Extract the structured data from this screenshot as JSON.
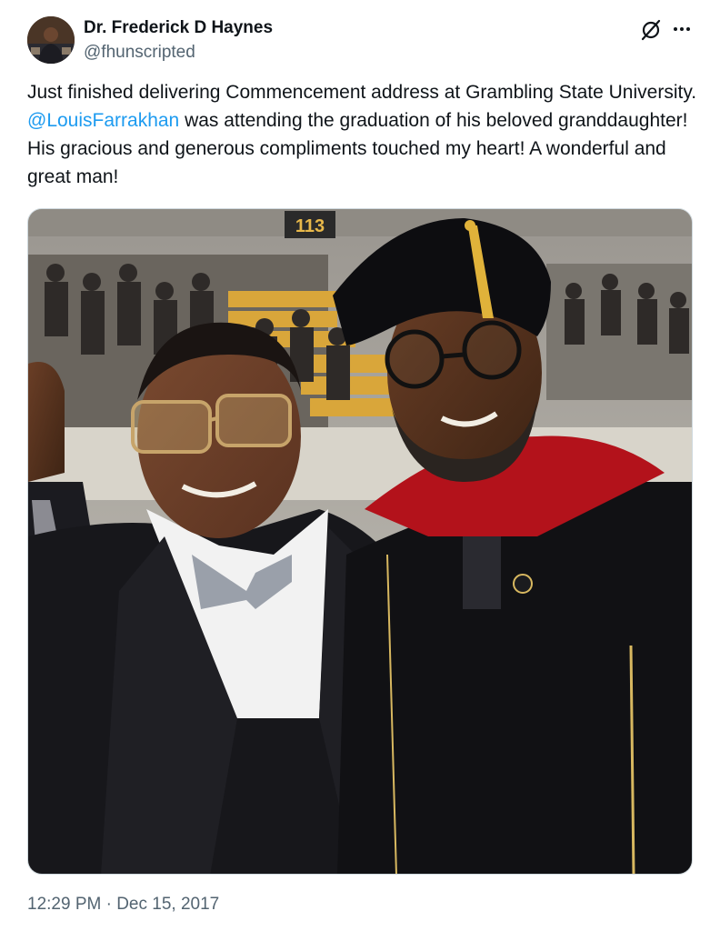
{
  "author": {
    "name": "Dr. Frederick D Haynes",
    "handle": "@fhunscripted"
  },
  "tweet": {
    "text_before": "Just finished delivering Commencement address at Grambling State University. ",
    "mention": "@LouisFarrakhan",
    "text_after": " was attending the graduation of his beloved granddaughter! His gracious and generous compliments touched my heart! A wonderful and great man!"
  },
  "media": {
    "scoreboard_text": "113"
  },
  "meta": {
    "timestamp": "12:29 PM · Dec 15, 2017"
  },
  "icons": {
    "grok": "grok-icon",
    "more": "more-options-icon"
  },
  "colors": {
    "text": "#0f1419",
    "secondary": "#536471",
    "link": "#1d9bf0",
    "hood_red": "#b3121b",
    "tassel_gold": "#e0b23a"
  }
}
